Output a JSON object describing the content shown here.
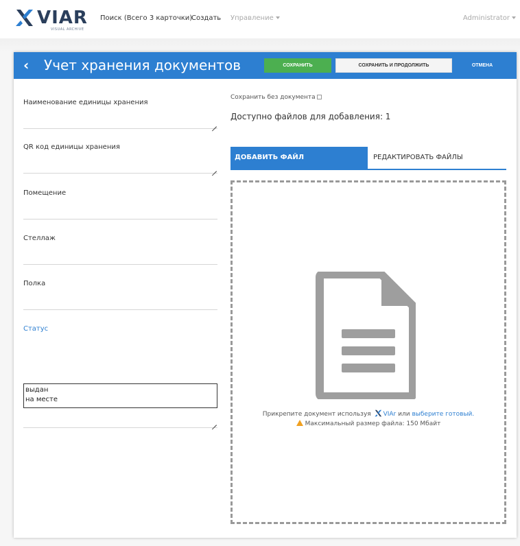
{
  "brand": {
    "name": "VIAR",
    "subtitle": "VISUAL ARCHIVE"
  },
  "nav": {
    "search": "Поиск (Всего 3 карточки)",
    "create": "Создать",
    "manage": "Управление",
    "user": "Administrator"
  },
  "header": {
    "back": "‹",
    "title": "Учет хранения документов",
    "save": "СОХРАНИТЬ",
    "save_continue": "СОХРАНИТЬ И ПРОДОЛЖИТЬ",
    "cancel": "ОТМЕНА"
  },
  "form": {
    "fields": [
      {
        "label": "Наименование единицы хранения",
        "value": ""
      },
      {
        "label": "QR код единицы хранения",
        "value": ""
      },
      {
        "label": "Помещение",
        "value": ""
      },
      {
        "label": "Стеллаж",
        "value": ""
      },
      {
        "label": "Полка",
        "value": ""
      }
    ],
    "status": {
      "label": "Статус",
      "options": [
        "выдан",
        "на месте"
      ]
    }
  },
  "upload": {
    "save_without_doc": "Сохранить без документа",
    "available": "Доступно файлов для добавления: 1",
    "tab_add": "ДОБАВИТЬ ФАЙЛ",
    "tab_edit": "РЕДАКТИРОВАТЬ ФАЙЛЫ",
    "attach_prefix": "Прикрепите документ используя",
    "attach_viar": "VIAr",
    "attach_or": "или",
    "attach_choose": "выберите готовый.",
    "max_size": "Максимальный размер файла: 150 Мбайт"
  },
  "colors": {
    "primary": "#2d7fd1",
    "save_button": "#4caf50",
    "warning": "#f0a020"
  }
}
